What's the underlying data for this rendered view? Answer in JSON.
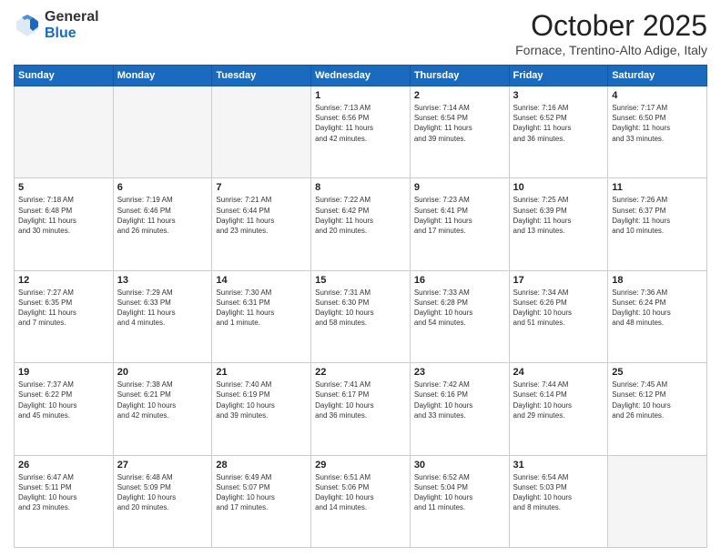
{
  "header": {
    "logo_general": "General",
    "logo_blue": "Blue",
    "title": "October 2025",
    "location": "Fornace, Trentino-Alto Adige, Italy"
  },
  "days_of_week": [
    "Sunday",
    "Monday",
    "Tuesday",
    "Wednesday",
    "Thursday",
    "Friday",
    "Saturday"
  ],
  "weeks": [
    [
      {
        "day": "",
        "info": ""
      },
      {
        "day": "",
        "info": ""
      },
      {
        "day": "",
        "info": ""
      },
      {
        "day": "1",
        "info": "Sunrise: 7:13 AM\nSunset: 6:56 PM\nDaylight: 11 hours\nand 42 minutes."
      },
      {
        "day": "2",
        "info": "Sunrise: 7:14 AM\nSunset: 6:54 PM\nDaylight: 11 hours\nand 39 minutes."
      },
      {
        "day": "3",
        "info": "Sunrise: 7:16 AM\nSunset: 6:52 PM\nDaylight: 11 hours\nand 36 minutes."
      },
      {
        "day": "4",
        "info": "Sunrise: 7:17 AM\nSunset: 6:50 PM\nDaylight: 11 hours\nand 33 minutes."
      }
    ],
    [
      {
        "day": "5",
        "info": "Sunrise: 7:18 AM\nSunset: 6:48 PM\nDaylight: 11 hours\nand 30 minutes."
      },
      {
        "day": "6",
        "info": "Sunrise: 7:19 AM\nSunset: 6:46 PM\nDaylight: 11 hours\nand 26 minutes."
      },
      {
        "day": "7",
        "info": "Sunrise: 7:21 AM\nSunset: 6:44 PM\nDaylight: 11 hours\nand 23 minutes."
      },
      {
        "day": "8",
        "info": "Sunrise: 7:22 AM\nSunset: 6:42 PM\nDaylight: 11 hours\nand 20 minutes."
      },
      {
        "day": "9",
        "info": "Sunrise: 7:23 AM\nSunset: 6:41 PM\nDaylight: 11 hours\nand 17 minutes."
      },
      {
        "day": "10",
        "info": "Sunrise: 7:25 AM\nSunset: 6:39 PM\nDaylight: 11 hours\nand 13 minutes."
      },
      {
        "day": "11",
        "info": "Sunrise: 7:26 AM\nSunset: 6:37 PM\nDaylight: 11 hours\nand 10 minutes."
      }
    ],
    [
      {
        "day": "12",
        "info": "Sunrise: 7:27 AM\nSunset: 6:35 PM\nDaylight: 11 hours\nand 7 minutes."
      },
      {
        "day": "13",
        "info": "Sunrise: 7:29 AM\nSunset: 6:33 PM\nDaylight: 11 hours\nand 4 minutes."
      },
      {
        "day": "14",
        "info": "Sunrise: 7:30 AM\nSunset: 6:31 PM\nDaylight: 11 hours\nand 1 minute."
      },
      {
        "day": "15",
        "info": "Sunrise: 7:31 AM\nSunset: 6:30 PM\nDaylight: 10 hours\nand 58 minutes."
      },
      {
        "day": "16",
        "info": "Sunrise: 7:33 AM\nSunset: 6:28 PM\nDaylight: 10 hours\nand 54 minutes."
      },
      {
        "day": "17",
        "info": "Sunrise: 7:34 AM\nSunset: 6:26 PM\nDaylight: 10 hours\nand 51 minutes."
      },
      {
        "day": "18",
        "info": "Sunrise: 7:36 AM\nSunset: 6:24 PM\nDaylight: 10 hours\nand 48 minutes."
      }
    ],
    [
      {
        "day": "19",
        "info": "Sunrise: 7:37 AM\nSunset: 6:22 PM\nDaylight: 10 hours\nand 45 minutes."
      },
      {
        "day": "20",
        "info": "Sunrise: 7:38 AM\nSunset: 6:21 PM\nDaylight: 10 hours\nand 42 minutes."
      },
      {
        "day": "21",
        "info": "Sunrise: 7:40 AM\nSunset: 6:19 PM\nDaylight: 10 hours\nand 39 minutes."
      },
      {
        "day": "22",
        "info": "Sunrise: 7:41 AM\nSunset: 6:17 PM\nDaylight: 10 hours\nand 36 minutes."
      },
      {
        "day": "23",
        "info": "Sunrise: 7:42 AM\nSunset: 6:16 PM\nDaylight: 10 hours\nand 33 minutes."
      },
      {
        "day": "24",
        "info": "Sunrise: 7:44 AM\nSunset: 6:14 PM\nDaylight: 10 hours\nand 29 minutes."
      },
      {
        "day": "25",
        "info": "Sunrise: 7:45 AM\nSunset: 6:12 PM\nDaylight: 10 hours\nand 26 minutes."
      }
    ],
    [
      {
        "day": "26",
        "info": "Sunrise: 6:47 AM\nSunset: 5:11 PM\nDaylight: 10 hours\nand 23 minutes."
      },
      {
        "day": "27",
        "info": "Sunrise: 6:48 AM\nSunset: 5:09 PM\nDaylight: 10 hours\nand 20 minutes."
      },
      {
        "day": "28",
        "info": "Sunrise: 6:49 AM\nSunset: 5:07 PM\nDaylight: 10 hours\nand 17 minutes."
      },
      {
        "day": "29",
        "info": "Sunrise: 6:51 AM\nSunset: 5:06 PM\nDaylight: 10 hours\nand 14 minutes."
      },
      {
        "day": "30",
        "info": "Sunrise: 6:52 AM\nSunset: 5:04 PM\nDaylight: 10 hours\nand 11 minutes."
      },
      {
        "day": "31",
        "info": "Sunrise: 6:54 AM\nSunset: 5:03 PM\nDaylight: 10 hours\nand 8 minutes."
      },
      {
        "day": "",
        "info": ""
      }
    ]
  ]
}
